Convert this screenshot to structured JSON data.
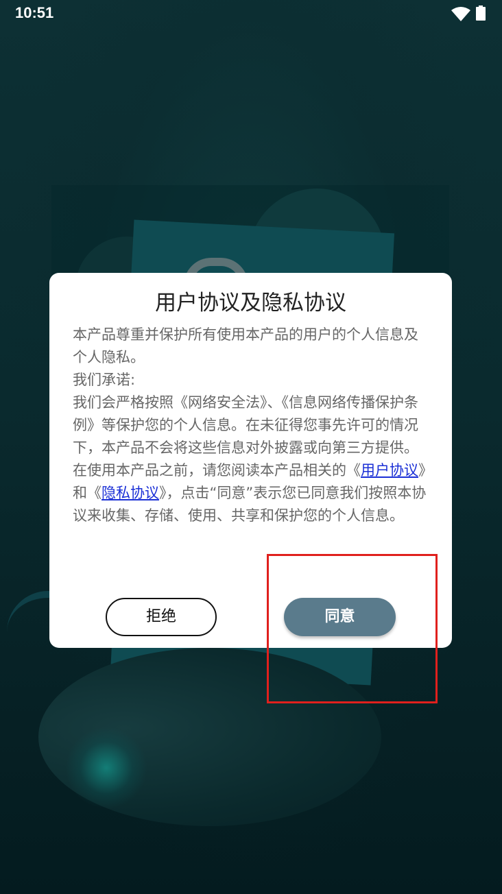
{
  "status_bar": {
    "time": "10:51",
    "wifi_icon": "wifi-icon",
    "battery_icon": "battery-icon"
  },
  "dialog": {
    "title": "用户协议及隐私协议",
    "paragraphs": {
      "p1": "本产品尊重并保护所有使用本产品的用户的个人信息及个人隐私。",
      "p2": "我们承诺:",
      "p3": "我们会严格按照《网络安全法》、《信息网络传播保护条例》等保护您的个人信息。在未征得您事先许可的情况下，本产品不会将这些信息对外披露或向第三方提供。",
      "p4_before": "在使用本产品之前，请您阅读本产品相关的《",
      "user_agreement_link": "用户协议",
      "p4_middle": "》和《",
      "privacy_agreement_link": "隐私协议",
      "p4_after": "》，点击“同意”表示您已同意我们按照本协议来收集、存储、使用、共享和保护您的个人信息。"
    },
    "refuse_label": "拒绝",
    "agree_label": "同意"
  },
  "colors": {
    "background": "#0b2a2e",
    "agree_button": "#5a7b8c",
    "link": "#1a2fd6",
    "highlight": "#e0201d"
  }
}
